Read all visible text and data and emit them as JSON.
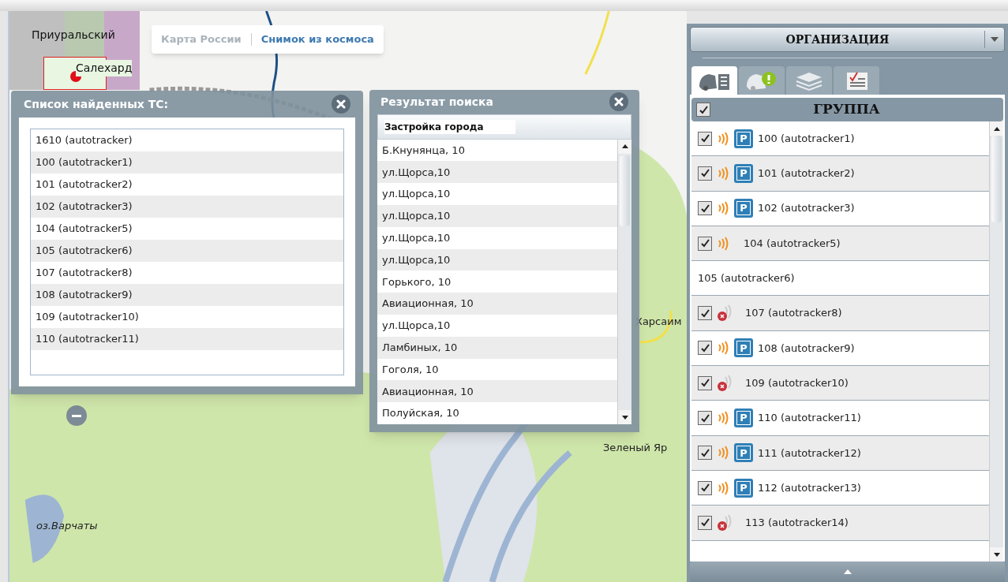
{
  "map": {
    "labels": [
      {
        "text": "Харсаим",
        "kind": "town"
      },
      {
        "text": "Зеленый Яр",
        "kind": "town"
      },
      {
        "text": "оз.Варчаты",
        "kind": "lake"
      }
    ],
    "inset": {
      "labels": [
        "Приуральский",
        "Салехард"
      ]
    },
    "layer_tabs": [
      {
        "label": "Карта России",
        "selected": false
      },
      {
        "label": "Снимок из космоса",
        "selected": true
      }
    ]
  },
  "vehicles_window": {
    "title": "Список найденных ТС:",
    "items": [
      "1610 (autotracker)",
      "100 (autotracker1)",
      "101 (autotracker2)",
      "102 (autotracker3)",
      "104 (autotracker5)",
      "105 (autotracker6)",
      "107 (autotracker8)",
      "108 (autotracker9)",
      "109 (autotracker10)",
      "110 (autotracker11)"
    ]
  },
  "search_window": {
    "title": "Результат поиска",
    "header": "Застройка города",
    "items": [
      "Б.Кнунянца, 10",
      "ул.Щорса,10",
      "ул.Щорса,10",
      "ул.Щорса,10",
      "ул.Щорса,10",
      "ул.Щорса,10",
      "Горького, 10",
      "Авиационная, 10",
      "ул.Щорса,10",
      "Ламбиных, 10",
      "Гоголя, 10",
      "Авиационная, 10",
      "Полуйская, 10"
    ]
  },
  "panel": {
    "organization": "ОРГАНИЗАЦИЯ",
    "tabs": [
      {
        "selected": true
      },
      {
        "selected": false
      },
      {
        "selected": false
      },
      {
        "selected": false
      }
    ],
    "group": {
      "label": "ГРУППА",
      "checked": true
    },
    "rows": [
      {
        "label": "100 (autotracker1)",
        "kind": "parked",
        "badge": "P",
        "checked": true
      },
      {
        "label": "101 (autotracker2)",
        "kind": "parked",
        "badge": "P",
        "checked": true
      },
      {
        "label": "102 (autotracker3)",
        "kind": "parked",
        "badge": "P",
        "checked": true
      },
      {
        "label": "104 (autotracker5)",
        "kind": "online",
        "checked": true
      },
      {
        "label": "105 (autotracker6)",
        "kind": "plain"
      },
      {
        "label": "107 (autotracker8)",
        "kind": "offline",
        "checked": true
      },
      {
        "label": "108 (autotracker9)",
        "kind": "parked",
        "badge": "P",
        "checked": true
      },
      {
        "label": "109 (autotracker10)",
        "kind": "offline",
        "checked": true
      },
      {
        "label": "110 (autotracker11)",
        "kind": "parked",
        "badge": "P",
        "checked": true
      },
      {
        "label": "111 (autotracker12)",
        "kind": "parked",
        "badge": "P",
        "checked": true
      },
      {
        "label": "112 (autotracker13)",
        "kind": "parked",
        "badge": "P",
        "checked": true
      },
      {
        "label": "113 (autotracker14)",
        "kind": "offline",
        "checked": true
      }
    ]
  }
}
